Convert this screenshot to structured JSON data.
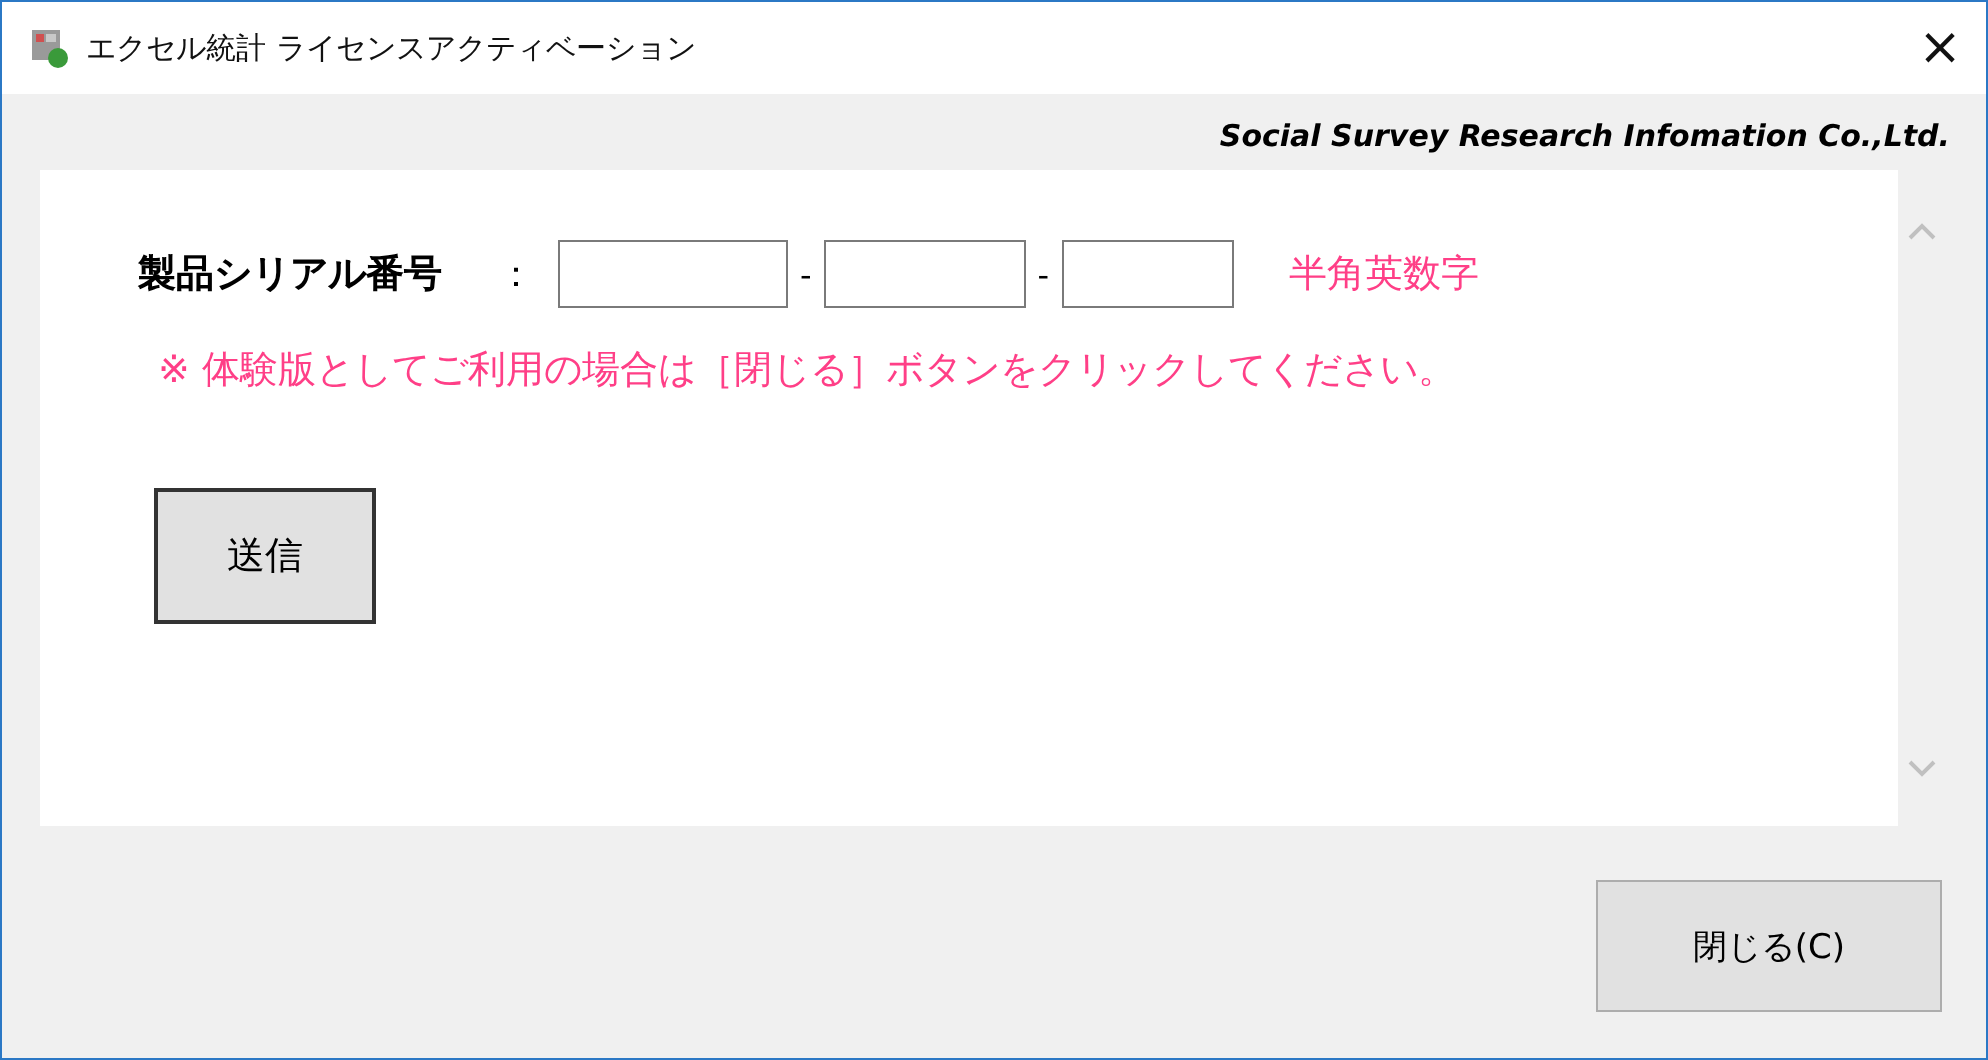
{
  "window": {
    "title": "エクセル統計 ライセンスアクティベーション",
    "close": "×"
  },
  "company": "Social Survey Research Infomation Co.,Ltd.",
  "serial": {
    "label": "製品シリアル番号",
    "colon": "：",
    "fields": [
      {
        "kind": "input"
      },
      {
        "kind": "input"
      },
      {
        "kind": "input"
      }
    ],
    "separators": [
      "-",
      "-"
    ],
    "hint": "半角英数字"
  },
  "note": "※ 体験版としてご利用の場合は［閉じる］ボタンをクリックしてください。",
  "submit": "送信",
  "close_button": "閉じる(C)"
}
